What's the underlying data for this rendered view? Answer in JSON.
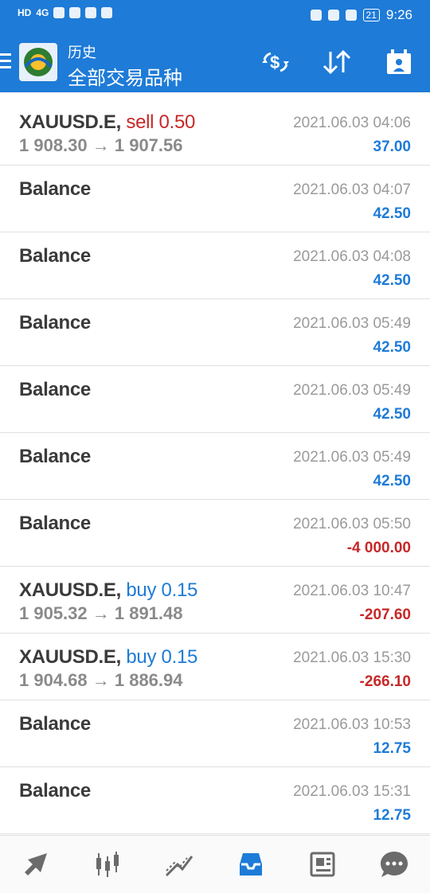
{
  "status_bar": {
    "left": [
      "HD",
      "4G"
    ],
    "time": "9:26",
    "battery": "21"
  },
  "header": {
    "subtitle": "历史",
    "title": "全部交易品种"
  },
  "items": [
    {
      "symbol": "XAUUSD.E,",
      "action": "sell 0.50",
      "action_type": "sell",
      "prices": "1 908.30 → 1 907.56",
      "date": "2021.06.03 04:06",
      "value": "37.00",
      "sign": "pos"
    },
    {
      "symbol": "Balance",
      "action": "",
      "action_type": "",
      "prices": "",
      "date": "2021.06.03 04:07",
      "value": "42.50",
      "sign": "pos"
    },
    {
      "symbol": "Balance",
      "action": "",
      "action_type": "",
      "prices": "",
      "date": "2021.06.03 04:08",
      "value": "42.50",
      "sign": "pos"
    },
    {
      "symbol": "Balance",
      "action": "",
      "action_type": "",
      "prices": "",
      "date": "2021.06.03 05:49",
      "value": "42.50",
      "sign": "pos"
    },
    {
      "symbol": "Balance",
      "action": "",
      "action_type": "",
      "prices": "",
      "date": "2021.06.03 05:49",
      "value": "42.50",
      "sign": "pos"
    },
    {
      "symbol": "Balance",
      "action": "",
      "action_type": "",
      "prices": "",
      "date": "2021.06.03 05:49",
      "value": "42.50",
      "sign": "pos"
    },
    {
      "symbol": "Balance",
      "action": "",
      "action_type": "",
      "prices": "",
      "date": "2021.06.03 05:50",
      "value": "-4 000.00",
      "sign": "neg"
    },
    {
      "symbol": "XAUUSD.E,",
      "action": "buy 0.15",
      "action_type": "buy",
      "prices": "1 905.32 → 1 891.48",
      "date": "2021.06.03 10:47",
      "value": "-207.60",
      "sign": "neg"
    },
    {
      "symbol": "XAUUSD.E,",
      "action": "buy 0.15",
      "action_type": "buy",
      "prices": "1 904.68 → 1 886.94",
      "date": "2021.06.03 15:30",
      "value": "-266.10",
      "sign": "neg"
    },
    {
      "symbol": "Balance",
      "action": "",
      "action_type": "",
      "prices": "",
      "date": "2021.06.03 10:53",
      "value": "12.75",
      "sign": "pos"
    },
    {
      "symbol": "Balance",
      "action": "",
      "action_type": "",
      "prices": "",
      "date": "2021.06.03 15:31",
      "value": "12.75",
      "sign": "pos"
    }
  ],
  "nav": [
    {
      "name": "nav-trade-arrow-icon",
      "active": false
    },
    {
      "name": "nav-quotes-candles-icon",
      "active": false
    },
    {
      "name": "nav-chart-trend-icon",
      "active": false
    },
    {
      "name": "nav-history-inbox-icon",
      "active": true
    },
    {
      "name": "nav-news-icon",
      "active": false
    },
    {
      "name": "nav-chat-icon",
      "active": false
    }
  ],
  "colors": {
    "primary": "#1e7bd7",
    "negative": "#c62828",
    "text": "#3a3a3a",
    "muted": "#9a9a9a"
  }
}
